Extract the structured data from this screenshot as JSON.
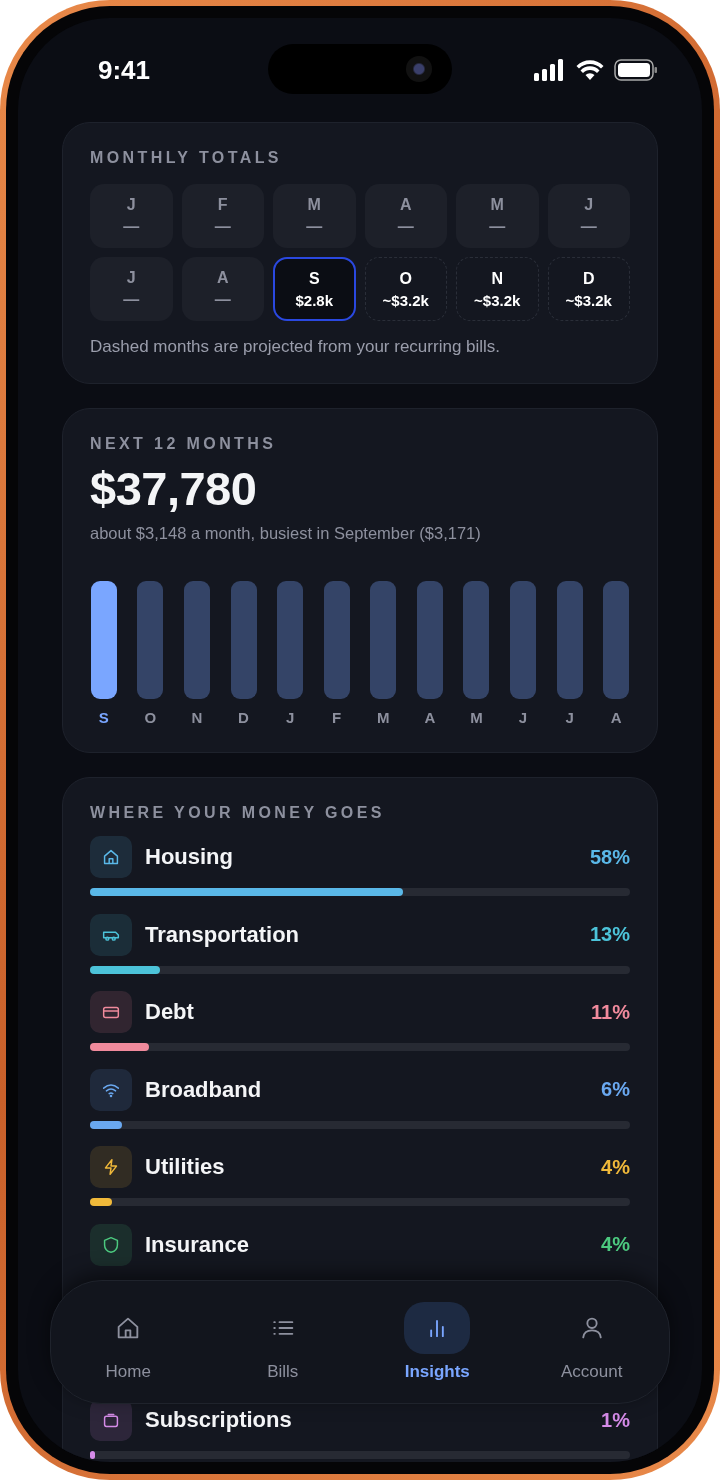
{
  "status_bar": {
    "time": "9:41"
  },
  "monthly_totals": {
    "title": "MONTHLY TOTALS",
    "months": [
      {
        "month": "J",
        "amount": "—",
        "kind": "past",
        "selected": false
      },
      {
        "month": "F",
        "amount": "—",
        "kind": "past",
        "selected": false
      },
      {
        "month": "M",
        "amount": "—",
        "kind": "past",
        "selected": false
      },
      {
        "month": "A",
        "amount": "—",
        "kind": "past",
        "selected": false
      },
      {
        "month": "M",
        "amount": "—",
        "kind": "past",
        "selected": false
      },
      {
        "month": "J",
        "amount": "—",
        "kind": "past",
        "selected": false
      },
      {
        "month": "J",
        "amount": "—",
        "kind": "past",
        "selected": false
      },
      {
        "month": "A",
        "amount": "—",
        "kind": "past",
        "selected": false
      },
      {
        "month": "S",
        "amount": "$2.8k",
        "kind": "actual",
        "selected": true
      },
      {
        "month": "O",
        "amount": "~$3.2k",
        "kind": "projected",
        "selected": false
      },
      {
        "month": "N",
        "amount": "~$3.2k",
        "kind": "projected",
        "selected": false
      },
      {
        "month": "D",
        "amount": "~$3.2k",
        "kind": "projected",
        "selected": false
      }
    ],
    "note": "Dashed months are projected from your recurring bills."
  },
  "next_12_months": {
    "title": "NEXT 12 MONTHS",
    "total": "$37,780",
    "summary": "about $3,148 a month, busiest in September ($3,171)",
    "bars": [
      {
        "label": "S",
        "selected": true
      },
      {
        "label": "O",
        "selected": false
      },
      {
        "label": "N",
        "selected": false
      },
      {
        "label": "D",
        "selected": false
      },
      {
        "label": "J",
        "selected": false
      },
      {
        "label": "F",
        "selected": false
      },
      {
        "label": "M",
        "selected": false
      },
      {
        "label": "A",
        "selected": false
      },
      {
        "label": "M",
        "selected": false
      },
      {
        "label": "J",
        "selected": false
      },
      {
        "label": "J",
        "selected": false
      },
      {
        "label": "A",
        "selected": false
      }
    ]
  },
  "spending": {
    "title": "WHERE YOUR MONEY GOES",
    "categories": [
      {
        "name": "Housing",
        "percent": "58%",
        "level": 0.58,
        "color": "#5ab8e8"
      },
      {
        "name": "Transportation",
        "percent": "13%",
        "level": 0.13,
        "color": "#4cc3d9"
      },
      {
        "name": "Debt",
        "percent": "11%",
        "level": 0.11,
        "color": "#f08a9c"
      },
      {
        "name": "Broadband",
        "percent": "6%",
        "level": 0.06,
        "color": "#6aa8f0"
      },
      {
        "name": "Utilities",
        "percent": "4%",
        "level": 0.04,
        "color": "#f0b93a"
      },
      {
        "name": "Insurance",
        "percent": "4%",
        "color": "#4cc97f"
      },
      {
        "name": "Subscriptions",
        "percent": "1%",
        "level": 0.01,
        "color": "#d58be8"
      }
    ]
  },
  "tab_bar": [
    {
      "label": "Home",
      "selected": false
    },
    {
      "label": "Bills",
      "selected": false
    },
    {
      "label": "Insights",
      "selected": true
    },
    {
      "label": "Account",
      "selected": false
    }
  ]
}
